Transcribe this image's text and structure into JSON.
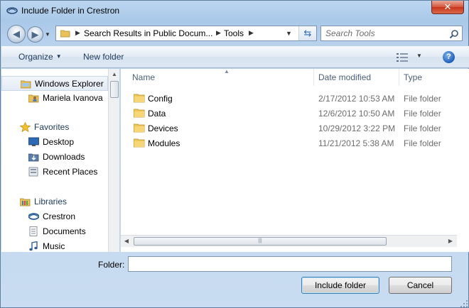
{
  "window": {
    "title": "Include Folder in Crestron",
    "close_label": "✕"
  },
  "address_bar": {
    "segments": [
      "Search Results in Public Docum...",
      "Tools"
    ],
    "search_placeholder": "Search Tools"
  },
  "toolbar": {
    "organize_label": "Organize",
    "new_folder_label": "New folder",
    "help_label": "?"
  },
  "nav_pane": {
    "items": [
      {
        "label": "Windows Explorer",
        "icon": "explorer-icon",
        "selected": true
      },
      {
        "label": "Mariela Ivanova",
        "icon": "user-folder-icon"
      },
      {
        "label": "Favorites",
        "icon": "star-icon"
      },
      {
        "label": "Desktop",
        "icon": "desktop-icon"
      },
      {
        "label": "Downloads",
        "icon": "downloads-icon"
      },
      {
        "label": "Recent Places",
        "icon": "recent-places-icon"
      },
      {
        "label": "Libraries",
        "icon": "libraries-icon"
      },
      {
        "label": "Crestron",
        "icon": "crestron-library-icon"
      },
      {
        "label": "Documents",
        "icon": "documents-icon"
      },
      {
        "label": "Music",
        "icon": "music-icon"
      }
    ]
  },
  "file_list": {
    "columns": [
      "Name",
      "Date modified",
      "Type"
    ],
    "rows": [
      {
        "name": "Config",
        "date": "2/17/2012 10:53 AM",
        "type": "File folder"
      },
      {
        "name": "Data",
        "date": "12/6/2012 10:50 AM",
        "type": "File folder"
      },
      {
        "name": "Devices",
        "date": "10/29/2012 3:22 PM",
        "type": "File folder"
      },
      {
        "name": "Modules",
        "date": "11/21/2012 5:38 AM",
        "type": "File folder"
      }
    ]
  },
  "footer": {
    "folder_label": "Folder:",
    "folder_value": "",
    "include_button": "Include folder",
    "cancel_button": "Cancel"
  }
}
